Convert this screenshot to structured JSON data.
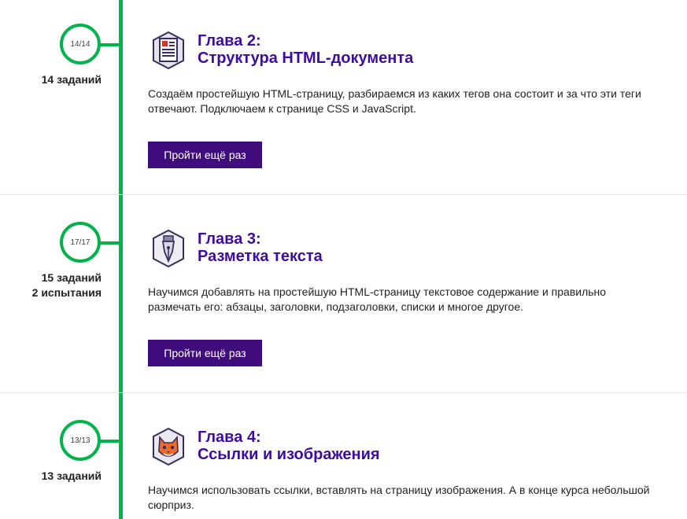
{
  "chapters": [
    {
      "progress": "14/14",
      "stats": [
        "14 заданий"
      ],
      "title_line1": "Глава 2:",
      "title_line2": "Структура HTML-документа",
      "icon": "document-icon",
      "description": "Создаём простейшую HTML-страницу, разбираемся из каких тегов она состоит и за что эти теги отвечают. Подключаем к странице CSS и JavaScript.",
      "button_label": "Пройти ещё раз"
    },
    {
      "progress": "17/17",
      "stats": [
        "15 заданий",
        "2 испытания"
      ],
      "title_line1": "Глава 3:",
      "title_line2": "Разметка текста",
      "icon": "fountain-pen-icon",
      "description": "Научимся добавлять на простейшую HTML-страницу текстовое содержание и правильно размечать его: абзацы, заголовки, подзаголовки, списки и многое другое.",
      "button_label": "Пройти ещё раз"
    },
    {
      "progress": "13/13",
      "stats": [
        "13 заданий"
      ],
      "title_line1": "Глава 4:",
      "title_line2": "Ссылки и изображения",
      "icon": "cat-icon",
      "description": "Научимся использовать ссылки, вставлять на страницу изображения. А в конце курса небольшой сюрприз."
    }
  ],
  "colors": {
    "accent_green": "#00b34a",
    "title_purple": "#3f0ca0",
    "button_purple": "#3f0c7c"
  }
}
